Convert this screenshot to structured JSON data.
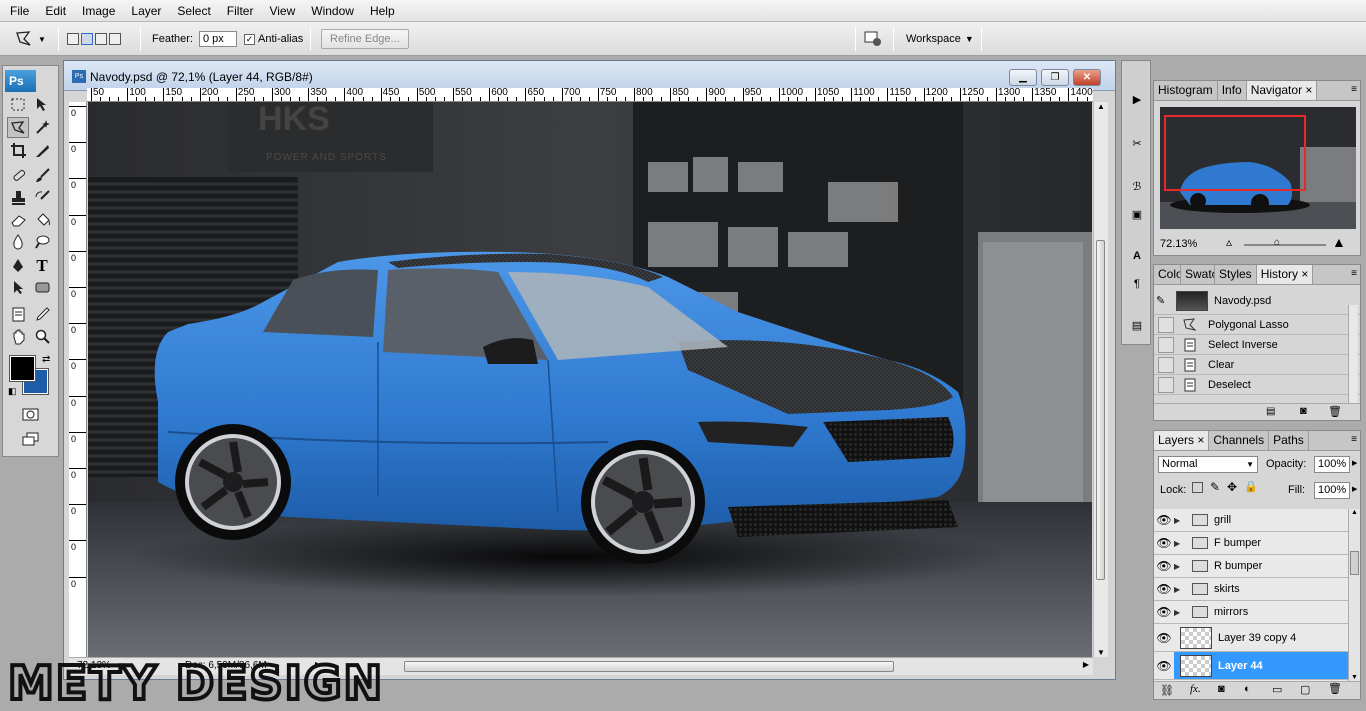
{
  "menubar": {
    "items": [
      "File",
      "Edit",
      "Image",
      "Layer",
      "Select",
      "Filter",
      "View",
      "Window",
      "Help"
    ]
  },
  "options": {
    "feather_label": "Feather:",
    "feather_value": "0 px",
    "antialias_label": "Anti-alias",
    "antialias_checked": true,
    "refine_edge_label": "Refine Edge...",
    "workspace_label": "Workspace"
  },
  "toolbox": {
    "logo": "Ps",
    "foreground_color": "#000000",
    "background_color": "#1d5ca8"
  },
  "document": {
    "title": "Navody.psd @ 72,1% (Layer 44, RGB/8#)",
    "ruler_top": [
      "50",
      "100",
      "150",
      "200",
      "250",
      "300",
      "350",
      "400",
      "450",
      "500",
      "550",
      "600",
      "650",
      "700",
      "750",
      "800",
      "850",
      "900",
      "950",
      "1000",
      "1050",
      "1100",
      "1150",
      "1200",
      "1250",
      "1300",
      "1350",
      "1400"
    ],
    "ruler_left": [
      "0",
      "0",
      "0",
      "0",
      "0",
      "0",
      "0",
      "0",
      "0",
      "0",
      "0",
      "0",
      "0",
      "0"
    ],
    "zoom_status": "72.13%",
    "doc_status": "Doc: 6,59M/86,6M",
    "canvas_text": "HKS",
    "canvas_subtext": "POWER AND SPORTS"
  },
  "navigator": {
    "tabs": [
      "Histogram",
      "Info",
      "Navigator"
    ],
    "active_tab": "Navigator",
    "zoom": "72.13%"
  },
  "history": {
    "tabs": [
      "Color",
      "Swatc",
      "Styles",
      "History"
    ],
    "active_tab": "History",
    "snapshot": "Navody.psd",
    "items": [
      "Polygonal Lasso",
      "Select Inverse",
      "Clear",
      "Deselect"
    ]
  },
  "layers": {
    "tabs": [
      "Layers",
      "Channels",
      "Paths"
    ],
    "active_tab": "Layers",
    "blend_mode": "Normal",
    "opacity_label": "Opacity:",
    "opacity": "100%",
    "lock_label": "Lock:",
    "fill_label": "Fill:",
    "fill": "100%",
    "groups": [
      "grill",
      "F bumper",
      "R bumper",
      "skirts",
      "mirrors"
    ],
    "layer_items": [
      {
        "name": "Layer 39 copy 4",
        "selected": false
      },
      {
        "name": "Layer 44",
        "selected": true
      }
    ]
  },
  "watermark": {
    "text": "METY DESIGN"
  },
  "colors": {
    "accent": "#3399ff",
    "car_blue": "#2f7ad0",
    "close_red": "#c1412a"
  }
}
